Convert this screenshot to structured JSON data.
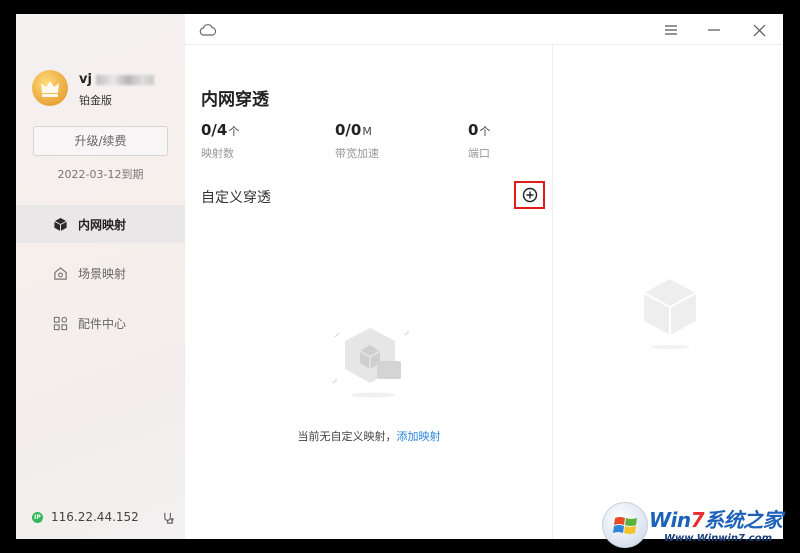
{
  "user": {
    "name_visible": "vj",
    "tier": "铂金版",
    "upgrade_label": "升级/续费",
    "expire_text": "2022-03-12到期"
  },
  "sidebar": {
    "items": [
      {
        "label": "内网映射",
        "icon": "cube-icon",
        "active": true
      },
      {
        "label": "场景映射",
        "icon": "home-icon",
        "active": false
      },
      {
        "label": "配件中心",
        "icon": "grid-icon",
        "active": false
      }
    ],
    "ip": "116.22.44.152",
    "ip_badge": "IP"
  },
  "main": {
    "title": "内网穿透",
    "stats": [
      {
        "value": "0/4",
        "unit": "个",
        "label": "映射数"
      },
      {
        "value": "0/0",
        "unit": "M",
        "label": "带宽加速"
      },
      {
        "value": "0",
        "unit": "个",
        "label": "端口"
      }
    ],
    "section_title": "自定义穿透",
    "empty_message": "当前无自定义映射，",
    "empty_link": "添加映射"
  },
  "watermark": {
    "text_prefix": "Win",
    "text_seven": "7",
    "text_suffix": "系统之家",
    "url": "Www.Winwin7.com"
  },
  "colors": {
    "accent_link": "#2a84e0",
    "highlight_box": "#e21a1a",
    "ip_status": "#35b65a"
  }
}
